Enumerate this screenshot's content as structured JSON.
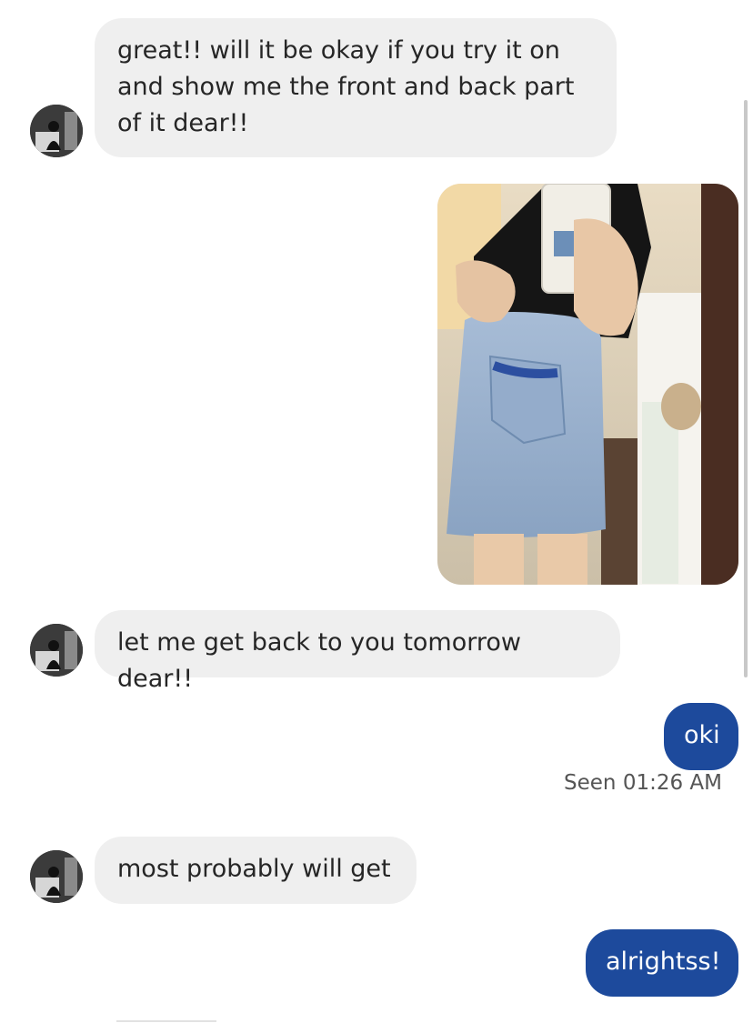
{
  "messages": [
    {
      "from": "them",
      "text": "great!! will it be okay if you try it on and show me the front and back part of it dear!!"
    },
    {
      "from": "me",
      "type": "photo"
    },
    {
      "from": "them",
      "text": "let me get back to you tomorrow dear!!"
    },
    {
      "from": "me",
      "text": "oki"
    },
    {
      "from": "them",
      "text": "most probably will get"
    },
    {
      "from": "me",
      "text": "alrightss!"
    }
  ],
  "seen_label": "Seen 01:26 AM",
  "colors": {
    "incoming_bubble": "#efefef",
    "outgoing_bubble": "#1d4a9c",
    "incoming_text": "#262626",
    "outgoing_text": "#ffffff"
  }
}
